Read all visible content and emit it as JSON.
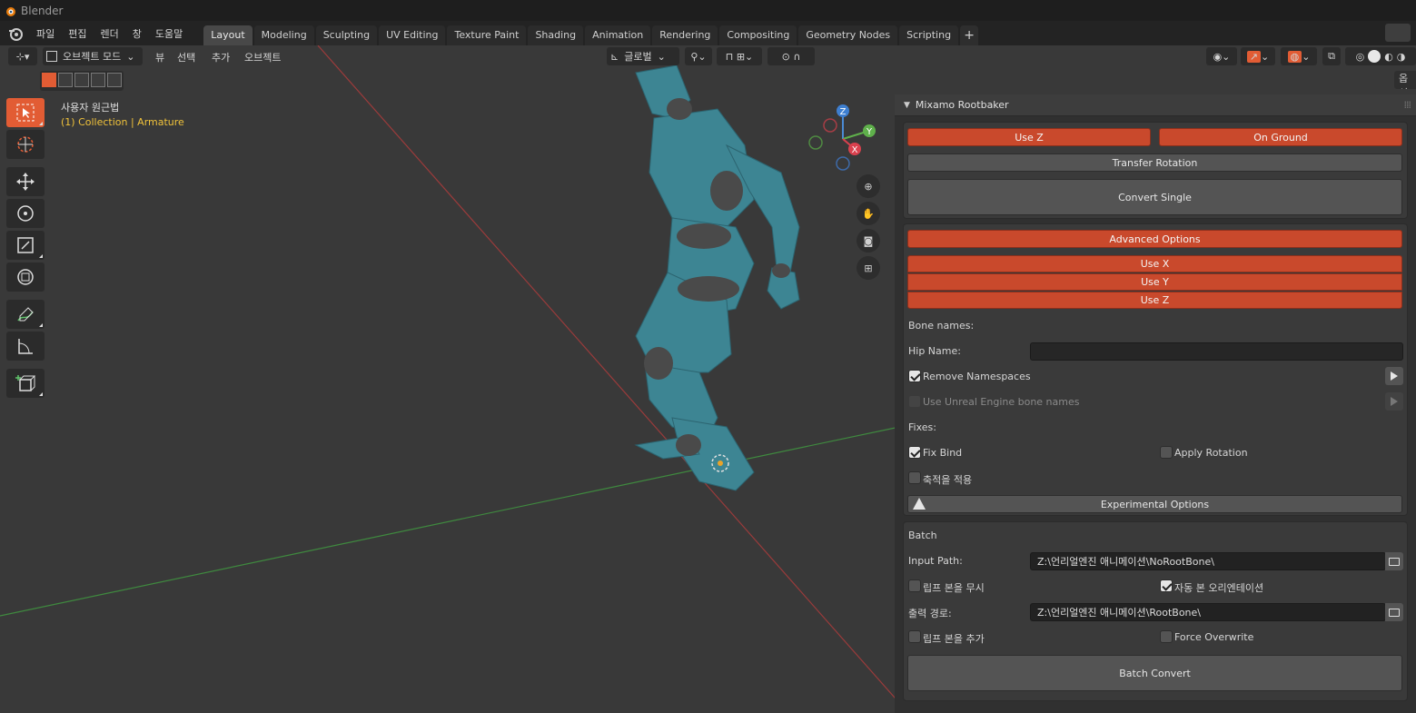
{
  "window": {
    "title": "Blender"
  },
  "menu": {
    "items": [
      "파일",
      "편집",
      "렌더",
      "창",
      "도움말"
    ]
  },
  "workspaces": {
    "tabs": [
      "Layout",
      "Modeling",
      "Sculpting",
      "UV Editing",
      "Texture Paint",
      "Shading",
      "Animation",
      "Rendering",
      "Compositing",
      "Geometry Nodes",
      "Scripting"
    ],
    "active": "Layout",
    "add_label": "+"
  },
  "viewport_header": {
    "mode_label": "오브젝트 모드",
    "menus": [
      "뷰",
      "선택",
      "추가",
      "오브젝트"
    ],
    "orientation_label": "글로벌",
    "options_label": "옵션"
  },
  "viewport": {
    "view_name": "사용자 원근법",
    "collection_info": "(1) Collection | Armature",
    "gizmo": {
      "x": "X",
      "y": "Y",
      "z": "Z"
    }
  },
  "panel": {
    "title": "Mixamo Rootbaker",
    "use_z_label": "Use Z",
    "on_ground_label": "On Ground",
    "transfer_rotation_label": "Transfer Rotation",
    "convert_single_label": "Convert Single",
    "advanced_options_label": "Advanced Options",
    "adv_use_x": "Use X",
    "adv_use_y": "Use Y",
    "adv_use_z": "Use Z",
    "bone_names_label": "Bone names:",
    "hip_name_label": "Hip Name:",
    "hip_name_value": "",
    "remove_namespaces_label": "Remove Namespaces",
    "unreal_bone_names_label": "Use Unreal Engine bone names",
    "fixes_label": "Fixes:",
    "fix_bind_label": "Fix Bind",
    "apply_rotation_label": "Apply Rotation",
    "apply_scale_label": "축적을 적용",
    "experimental_options_label": "Experimental Options",
    "batch_label": "Batch",
    "input_path_label": "Input Path:",
    "input_path_value": "Z:\\언리얼엔진 애니메이션\\NoRootBone\\",
    "ignore_root_label": "립프 본을 무시",
    "auto_bone_orientation_label": "자동 본 오리엔테이션",
    "output_path_label": "출력 경로:",
    "output_path_value": "Z:\\언리얼엔진 애니메이션\\RootBone\\",
    "add_root_label": "립프 본을 추가",
    "force_overwrite_label": "Force Overwrite",
    "batch_convert_label": "Batch Convert"
  },
  "colors": {
    "accent": "#e25c34",
    "panel_button_red": "#c9492c",
    "collection_text": "#f0c23a"
  }
}
